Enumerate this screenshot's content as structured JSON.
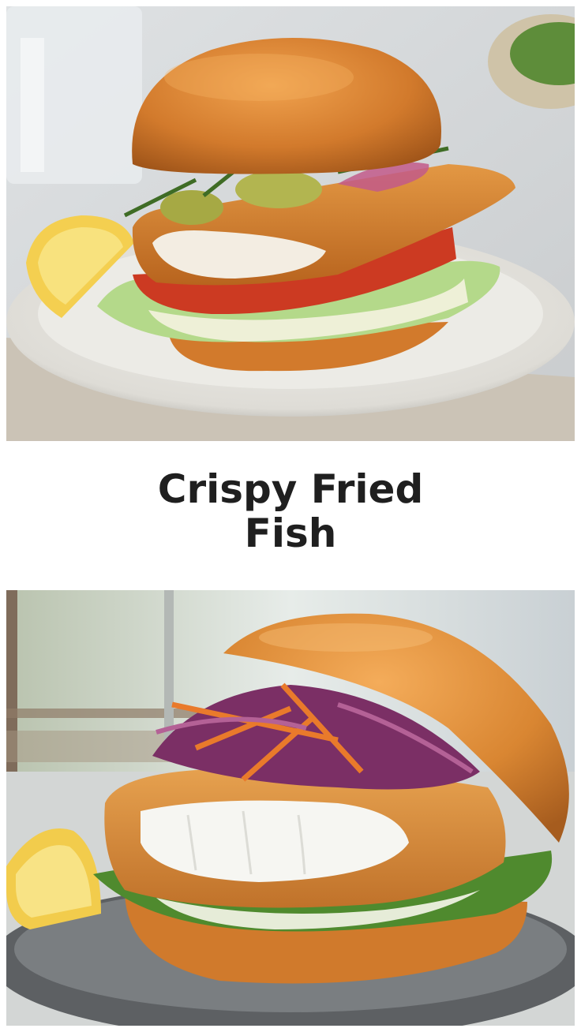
{
  "title": {
    "line1": "Crispy Fried",
    "line2": "Fish"
  },
  "images": {
    "top": {
      "subject": "fish-sandwich-with-pickles-dill-tomato-lettuce"
    },
    "bottom": {
      "subject": "fish-sandwich-with-slaw-greens"
    }
  },
  "colors": {
    "bun": "#d07a2c",
    "breading": "#d98a3a",
    "tomato": "#c9361f",
    "lettuce": "#9ac46a",
    "cabbage": "#7a2e63",
    "carrot": "#e77a2a",
    "lemon": "#f2cc4c",
    "plate": "#e8e6e1",
    "title_text": "#1f1f1f"
  }
}
